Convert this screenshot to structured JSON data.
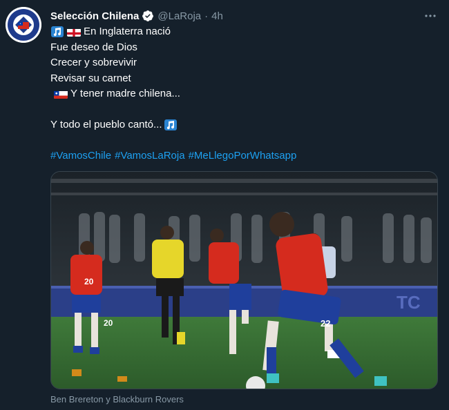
{
  "tweet": {
    "display_name": "Selección Chilena",
    "handle": "@LaRoja",
    "separator": "·",
    "time": "4h",
    "more_icon": "ellipsis-icon",
    "lines": [
      "En Inglaterra nació",
      "Fue deseo de Dios",
      "Crecer y sobrevivir",
      "Revisar su carnet",
      "Y tener madre chilena...",
      "Y todo el pueblo cantó..."
    ],
    "hashtags": [
      "#VamosChile",
      "#VamosLaRoja",
      "#MeLlegoPorWhatsapp"
    ],
    "media_caption": "Ben Brereton y Blackburn Rovers"
  },
  "colors": {
    "background": "#15202b",
    "text": "#ffffff",
    "muted": "#8899a6",
    "link": "#1da1f2"
  }
}
